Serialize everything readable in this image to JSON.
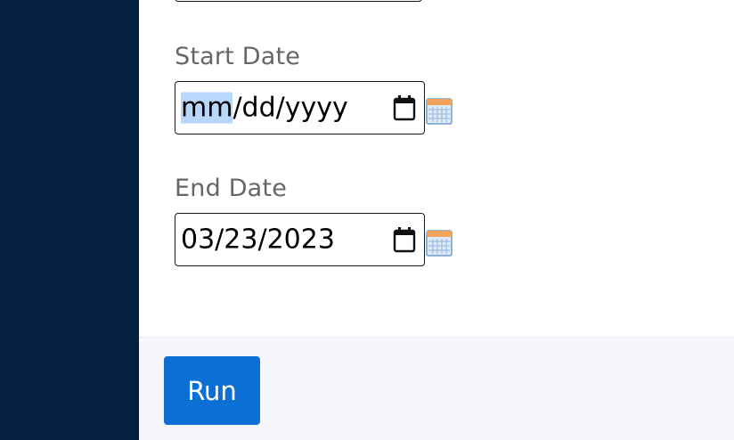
{
  "form": {
    "start_date": {
      "label": "Start Date",
      "value_parts": [
        "mm",
        "/dd/yyyy"
      ]
    },
    "end_date": {
      "label": "End Date",
      "value": "03/23/2023"
    }
  },
  "footer": {
    "run_label": "Run"
  },
  "colors": {
    "sidebar": "#03203f",
    "run_button": "#0b6fd6",
    "footer_bg": "#f5f6fa",
    "selection": "#b9d7fb"
  },
  "icons": {
    "picker": "calendar-icon",
    "side": "calendar-grid-icon"
  }
}
